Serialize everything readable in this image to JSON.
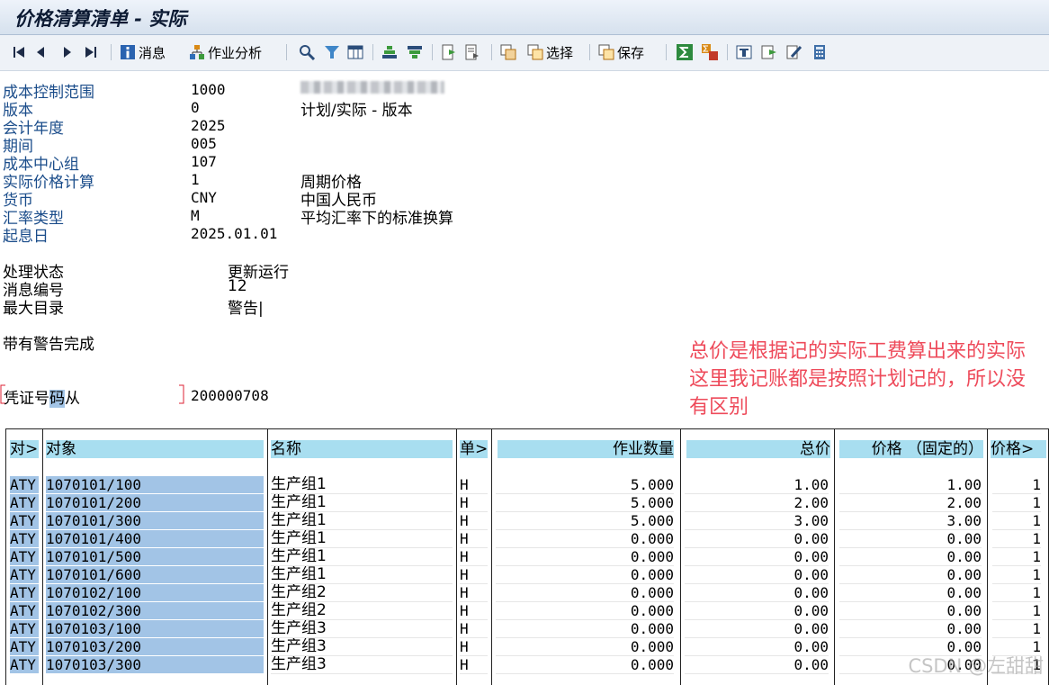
{
  "title": "价格清算清单 - 实际",
  "toolbar": {
    "msg_label": "消息",
    "analysis_label": "作业分析",
    "select_label": "选择",
    "save_label": "保存"
  },
  "header": {
    "fields": [
      {
        "label": "成本控制范围",
        "value": "1000",
        "desc": ""
      },
      {
        "label": "版本",
        "value": "0",
        "desc": "计划/实际 - 版本"
      },
      {
        "label": "会计年度",
        "value": "2025",
        "desc": ""
      },
      {
        "label": "期间",
        "value": "005",
        "desc": ""
      },
      {
        "label": "成本中心组",
        "value": "107",
        "desc": ""
      },
      {
        "label": "实际价格计算",
        "value": "1",
        "desc": "周期价格"
      },
      {
        "label": "货币",
        "value": "CNY",
        "desc": "中国人民币"
      },
      {
        "label": "汇率类型",
        "value": "M",
        "desc": "平均汇率下的标准换算"
      },
      {
        "label": "起息日",
        "value": "2025.01.01",
        "desc": ""
      }
    ],
    "status": [
      {
        "label": "处理状态",
        "value": "更新运行"
      },
      {
        "label": "消息编号",
        "value": "12"
      },
      {
        "label": "最大目录",
        "value": "警告|"
      }
    ],
    "completion": "带有警告完成",
    "voucher_label_pre": "凭证号",
    "voucher_label_hl": "码",
    "voucher_label_post": "从",
    "voucher_value": "200000708"
  },
  "annotation": "总价是根据记的实际工费算出来的实际这里我记账都是按照计划记的，所以没有区别",
  "table": {
    "headers": [
      "对>",
      "对象",
      "名称",
      "单>",
      "作业数量",
      "总价",
      "价格 （固定的）",
      "价格>"
    ],
    "rows": [
      {
        "type": "ATY",
        "object": "1070101/100",
        "name": "生产组1",
        "unit": "H",
        "qty": "5.000",
        "total": "1.00",
        "price": "1.00",
        "price2": "1"
      },
      {
        "type": "ATY",
        "object": "1070101/200",
        "name": "生产组1",
        "unit": "H",
        "qty": "5.000",
        "total": "2.00",
        "price": "2.00",
        "price2": "1"
      },
      {
        "type": "ATY",
        "object": "1070101/300",
        "name": "生产组1",
        "unit": "H",
        "qty": "5.000",
        "total": "3.00",
        "price": "3.00",
        "price2": "1"
      },
      {
        "type": "ATY",
        "object": "1070101/400",
        "name": "生产组1",
        "unit": "H",
        "qty": "0.000",
        "total": "0.00",
        "price": "0.00",
        "price2": "1"
      },
      {
        "type": "ATY",
        "object": "1070101/500",
        "name": "生产组1",
        "unit": "H",
        "qty": "0.000",
        "total": "0.00",
        "price": "0.00",
        "price2": "1"
      },
      {
        "type": "ATY",
        "object": "1070101/600",
        "name": "生产组1",
        "unit": "H",
        "qty": "0.000",
        "total": "0.00",
        "price": "0.00",
        "price2": "1"
      },
      {
        "type": "ATY",
        "object": "1070102/100",
        "name": "生产组2",
        "unit": "H",
        "qty": "0.000",
        "total": "0.00",
        "price": "0.00",
        "price2": "1"
      },
      {
        "type": "ATY",
        "object": "1070102/300",
        "name": "生产组2",
        "unit": "H",
        "qty": "0.000",
        "total": "0.00",
        "price": "0.00",
        "price2": "1"
      },
      {
        "type": "ATY",
        "object": "1070103/100",
        "name": "生产组3",
        "unit": "H",
        "qty": "0.000",
        "total": "0.00",
        "price": "0.00",
        "price2": "1"
      },
      {
        "type": "ATY",
        "object": "1070103/200",
        "name": "生产组3",
        "unit": "H",
        "qty": "0.000",
        "total": "0.00",
        "price": "0.00",
        "price2": "1"
      },
      {
        "type": "ATY",
        "object": "1070103/300",
        "name": "生产组3",
        "unit": "H",
        "qty": "0.000",
        "total": "0.00",
        "price": "0.00",
        "price2": "1"
      }
    ]
  },
  "watermark": "CSDN @左甜甜",
  "colors": {
    "accent_label": "#1a4c8a",
    "annotation": "#ee4b5b",
    "header_fill": "#a8def0",
    "selection": "#a2c4e6"
  }
}
